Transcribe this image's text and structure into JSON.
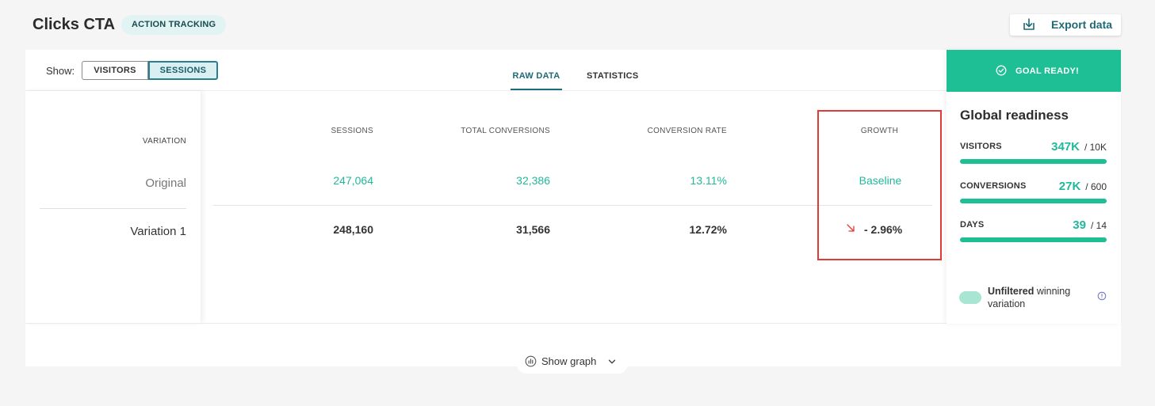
{
  "header": {
    "title": "Clicks CTA",
    "badge": "ACTION TRACKING",
    "export_label": "Export data"
  },
  "controls": {
    "show_label": "Show:",
    "toggle_visitors": "VISITORS",
    "toggle_sessions": "SESSIONS"
  },
  "tabs": [
    {
      "label": "RAW DATA",
      "active": true
    },
    {
      "label": "STATISTICS",
      "active": false
    }
  ],
  "table": {
    "variation_header": "VARIATION",
    "columns": [
      "SESSIONS",
      "TOTAL CONVERSIONS",
      "CONVERSION RATE",
      "GROWTH"
    ],
    "rows": [
      {
        "name": "Original",
        "sessions": "247,064",
        "conversions": "32,386",
        "rate": "13.11%",
        "growth": "Baseline"
      },
      {
        "name": "Variation 1",
        "sessions": "248,160",
        "conversions": "31,566",
        "rate": "12.72%",
        "growth": "- 2.96%"
      }
    ]
  },
  "goal": {
    "banner": "GOAL READY!",
    "title": "Global readiness",
    "metrics": [
      {
        "label": "VISITORS",
        "value": "347K",
        "target": "/ 10K",
        "progress": 1.0
      },
      {
        "label": "CONVERSIONS",
        "value": "27K",
        "target": "/ 600",
        "progress": 1.0
      },
      {
        "label": "DAYS",
        "value": "39",
        "target": "/ 14",
        "progress": 1.0
      }
    ],
    "unfiltered_bold": "Unfiltered",
    "unfiltered_rest": " winning variation"
  },
  "footer": {
    "show_graph": "Show graph"
  },
  "colors": {
    "accent": "#1fbf96",
    "teal_dark": "#1e6a76",
    "positive": "#22b89a",
    "negative": "#e53935"
  }
}
